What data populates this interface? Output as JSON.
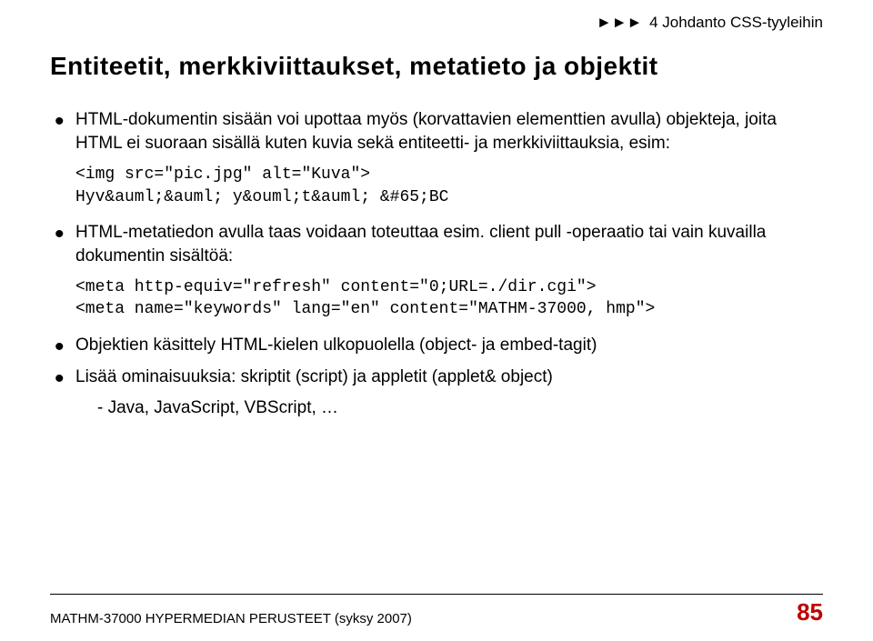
{
  "breadcrumb": {
    "arrows": "►►►",
    "text": "4 Johdanto CSS-tyyleihin"
  },
  "title": "Entiteetit, merkkiviittaukset, metatieto ja objektit",
  "bullets": {
    "b1": "HTML-dokumentin sisään voi upottaa myös (korvattavien elementtien avulla) objekteja, joita HTML ei suoraan sisällä kuten kuvia sekä entiteetti- ja merkkiviittauksia, esim:",
    "b2": "HTML-metatiedon avulla  taas voidaan toteuttaa esim. client pull -operaatio tai vain kuvailla dokumentin sisältöä:",
    "b3": "Objektien käsittely HTML-kielen ulkopuolella (object- ja embed-tagit)",
    "b4": "Lisää ominaisuuksia: skriptit (script) ja appletit (applet& object)",
    "b4sub": "Java, JavaScript, VBScript, …"
  },
  "code1": "<img src=\"pic.jpg\" alt=\"Kuva\">\nHyv&auml;&auml; y&ouml;t&auml; &#65;BC",
  "code2": "<meta http-equiv=\"refresh\" content=\"0;URL=./dir.cgi\">\n<meta name=\"keywords\" lang=\"en\" content=\"MATHM-37000, hmp\">",
  "footer": {
    "left": "MATHM-37000 HYPERMEDIAN PERUSTEET (syksy 2007)",
    "right": "85"
  }
}
